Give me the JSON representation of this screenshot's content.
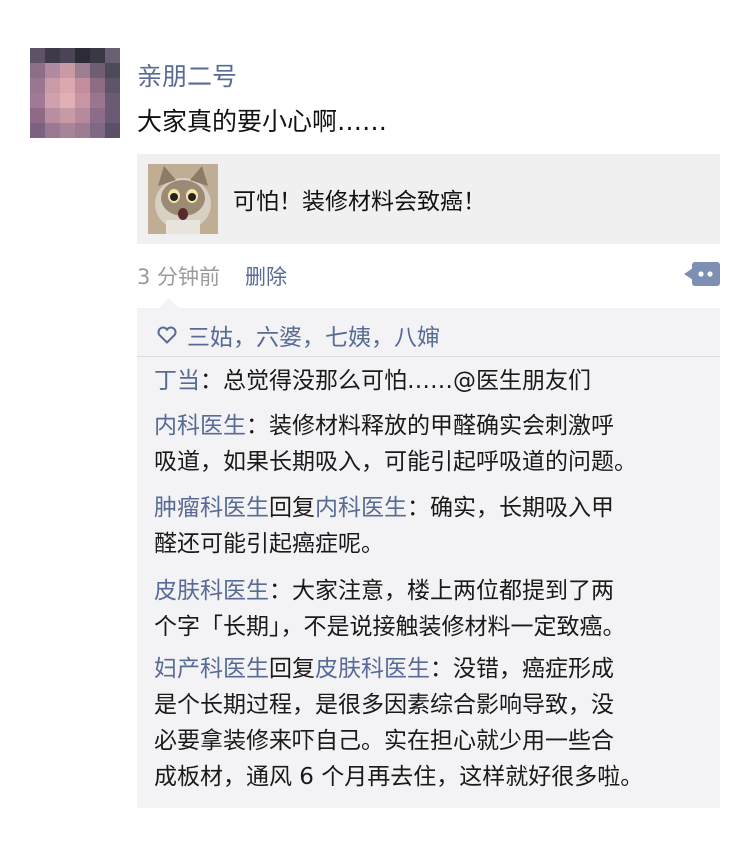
{
  "post": {
    "author": "亲朋二号",
    "text": "大家真的要小心啊……",
    "link_title": "可怕！装修材料会致癌！",
    "time": "3 分钟前",
    "delete_label": "删除"
  },
  "likes": [
    "三姑",
    "六婆",
    "七姨",
    "八婶"
  ],
  "comments": [
    {
      "author": "丁当",
      "text": "：总觉得没那么可怕……@医生朋友们"
    },
    {
      "author": "内科医生",
      "text": "：装修材料释放的甲醛确实会刺激呼",
      "text2": "吸道，如果长期吸入，可能引起呼吸道的问题。"
    },
    {
      "author": "肿瘤科医生",
      "reply_word": "回复",
      "reply_to": "内科医生",
      "text": "：确实，长期吸入甲",
      "text2": "醛还可能引起癌症呢。"
    },
    {
      "author": "皮肤科医生",
      "text": "：大家注意，楼上两位都提到了两",
      "text2": "个字「长期」，不是说接触装修材料一定致癌。"
    },
    {
      "author": "妇产科医生",
      "reply_word": "回复",
      "reply_to": "皮肤科医生",
      "text": "：没错，癌症形成",
      "text2": "是个长期过程，是很多因素综合影响导致，没",
      "text3": "必要拿装修来吓自己。实在担心就少用一些合",
      "text4": "成板材，通风 6 个月再去住，这样就好很多啦。"
    }
  ],
  "colors": {
    "link": "#576b95",
    "bubble_bg": "#f3f3f5",
    "card_bg": "#f0f0f0"
  }
}
